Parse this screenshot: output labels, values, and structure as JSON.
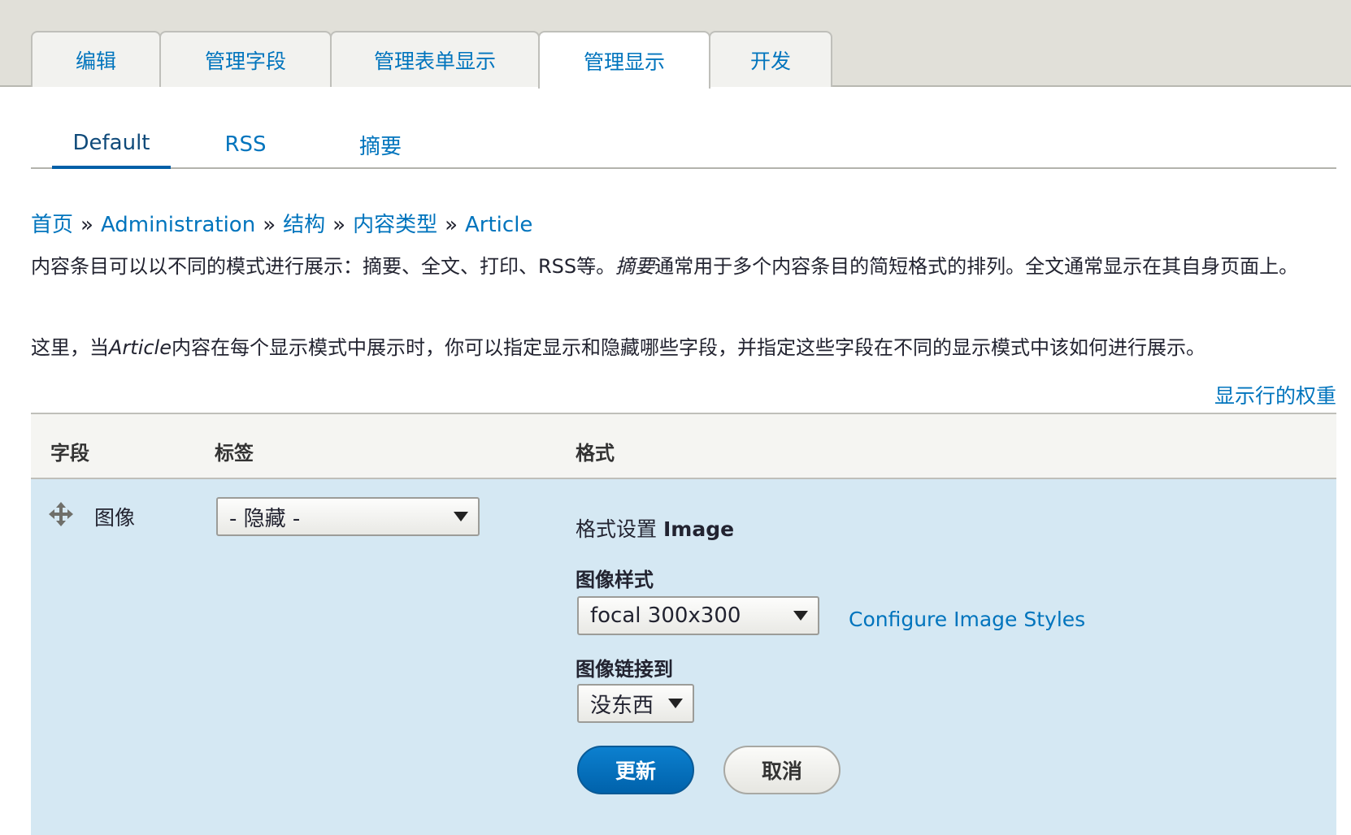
{
  "primary_tabs": [
    {
      "label": "编辑"
    },
    {
      "label": "管理字段"
    },
    {
      "label": "管理表单显示"
    },
    {
      "label": "管理显示",
      "active": true
    },
    {
      "label": "开发"
    }
  ],
  "secondary_tabs": [
    {
      "label": "Default",
      "active": true
    },
    {
      "label": "RSS"
    },
    {
      "label": "摘要"
    }
  ],
  "breadcrumb": [
    "首页",
    "Administration",
    "结构",
    "内容类型",
    "Article"
  ],
  "breadcrumb_sep": "»",
  "description": {
    "p1_a": "内容条目可以以不同的模式进行展示：摘要、全文、打印、RSS等。",
    "p1_em": "摘要",
    "p1_b": "通常用于多个内容条目的简短格式的排列。全文通常显示在其自身页面上。",
    "p2_a": "这里，当",
    "p2_em": "Article",
    "p2_b": "内容在每个显示模式中展示时，你可以指定显示和隐藏哪些字段，并指定这些字段在不同的显示模式中该如何进行展示。"
  },
  "weights_link": "显示行的权重",
  "table": {
    "headers": [
      "字段",
      "标签",
      "格式"
    ],
    "row": {
      "field": "图像",
      "label_value": "- 隐藏 -",
      "format_settings_prefix": "格式设置",
      "format_settings_name": "Image",
      "image_style_label": "图像样式",
      "image_style_value": "focal 300x300",
      "configure_link": "Configure Image Styles",
      "image_link_label": "图像链接到",
      "image_link_value": "没东西",
      "update_button": "更新",
      "cancel_button": "取消"
    }
  }
}
